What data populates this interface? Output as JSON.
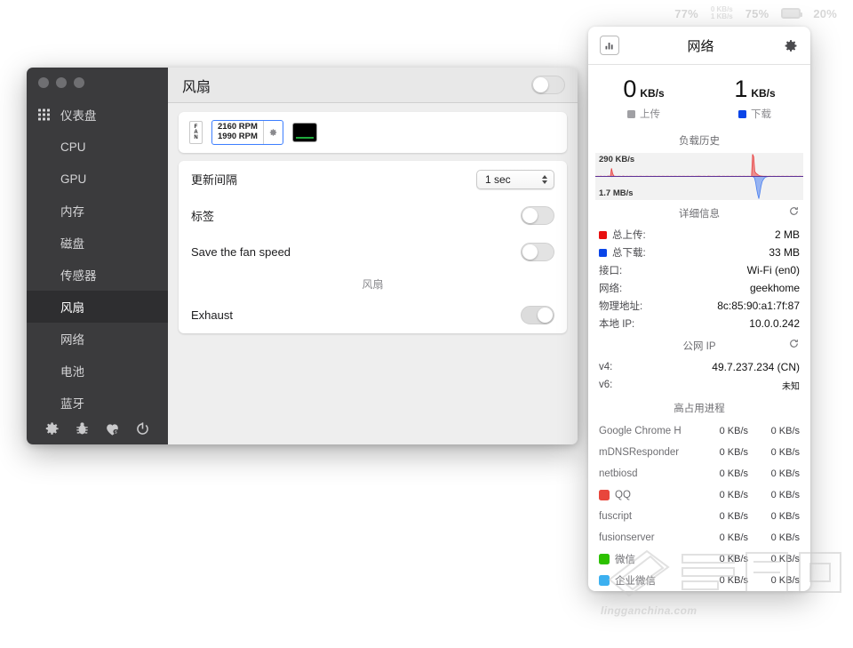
{
  "menubar": {
    "items": [
      {
        "name": "cpu-percent",
        "type": "text",
        "label": "77%"
      },
      {
        "name": "network-speed",
        "type": "stack",
        "top": "0 KB/s",
        "bottom": "1 KB/s"
      },
      {
        "name": "memory-percent",
        "type": "text",
        "label": "75%"
      },
      {
        "name": "battery-icon",
        "type": "battery",
        "label": ""
      },
      {
        "name": "battery-percent",
        "type": "text",
        "label": "20%"
      }
    ]
  },
  "window": {
    "sidebar": {
      "items": [
        {
          "label": "仪表盘",
          "icon": "grid-icon",
          "active": false
        },
        {
          "label": "CPU",
          "icon": "",
          "active": false
        },
        {
          "label": "GPU",
          "icon": "",
          "active": false
        },
        {
          "label": "内存",
          "icon": "",
          "active": false
        },
        {
          "label": "磁盘",
          "icon": "",
          "active": false
        },
        {
          "label": "传感器",
          "icon": "",
          "active": false
        },
        {
          "label": "风扇",
          "icon": "",
          "active": true
        },
        {
          "label": "网络",
          "icon": "",
          "active": false
        },
        {
          "label": "电池",
          "icon": "",
          "active": false
        },
        {
          "label": "蓝牙",
          "icon": "",
          "active": false
        }
      ],
      "tools": [
        "gear-icon",
        "bug-icon",
        "heart-dollar-icon",
        "power-icon"
      ]
    },
    "header": {
      "title": "风扇",
      "toggle_on": false
    },
    "fan_widget": {
      "tag": "FAN",
      "rpm_line1": "2160 RPM",
      "rpm_line2": "1990 RPM",
      "color_swatch": "#000000",
      "accent_bar": "#1faa3c"
    },
    "settings": {
      "update_interval_label": "更新间隔",
      "update_interval_value": "1 sec",
      "label_row": "标签",
      "label_row_on": false,
      "save_fan_speed": "Save the fan speed",
      "save_fan_speed_on": false,
      "section_title": "风扇",
      "exhaust_label": "Exhaust",
      "exhaust_on": true
    }
  },
  "popover": {
    "title": "网络",
    "chart_button": "bar-chart-icon",
    "gear_button": "gear-icon",
    "upload": {
      "value": "0",
      "unit": "KB/s",
      "label": "上传",
      "color": "#a0a0a4"
    },
    "download": {
      "value": "1",
      "unit": "KB/s",
      "label": "下载",
      "color": "#0a45e8"
    },
    "history_title": "负载历史",
    "chart_top_label": "290 KB/s",
    "chart_bottom_label": "1.7 MB/s",
    "details_title": "详细信息",
    "details": [
      {
        "key": "总上传:",
        "value": "2 MB",
        "swatch": "#e81010"
      },
      {
        "key": "总下载:",
        "value": "33 MB",
        "swatch": "#0a45e8"
      },
      {
        "key": "接口:",
        "value": "Wi-Fi (en0)",
        "swatch": ""
      },
      {
        "key": "网络:",
        "value": "geekhome",
        "swatch": ""
      },
      {
        "key": "物理地址:",
        "value": "8c:85:90:a1:7f:87",
        "swatch": ""
      },
      {
        "key": "本地 IP:",
        "value": "10.0.0.242",
        "swatch": ""
      }
    ],
    "public_ip_title": "公网 IP",
    "public_ip": [
      {
        "key": "v4:",
        "value": "49.7.237.234 (CN)",
        "small": false
      },
      {
        "key": "v6:",
        "value": "未知",
        "small": true
      }
    ],
    "processes_title": "高占用进程",
    "processes": [
      {
        "name": "Google Chrome H",
        "up": "0 KB/s",
        "down": "0 KB/s",
        "icon_color": ""
      },
      {
        "name": "mDNSResponder",
        "up": "0 KB/s",
        "down": "0 KB/s",
        "icon_color": ""
      },
      {
        "name": "netbiosd",
        "up": "0 KB/s",
        "down": "0 KB/s",
        "icon_color": ""
      },
      {
        "name": "QQ",
        "up": "0 KB/s",
        "down": "0 KB/s",
        "icon_color": "#e8463c"
      },
      {
        "name": "fuscript",
        "up": "0 KB/s",
        "down": "0 KB/s",
        "icon_color": ""
      },
      {
        "name": "fusionserver",
        "up": "0 KB/s",
        "down": "0 KB/s",
        "icon_color": ""
      },
      {
        "name": "微信",
        "up": "0 KB/s",
        "down": "0 KB/s",
        "icon_color": "#2dc100"
      },
      {
        "name": "企业微信",
        "up": "0 KB/s",
        "down": "0 KB/s",
        "icon_color": "#3cb0f0"
      }
    ]
  },
  "watermark": {
    "text": "lingganchina.com"
  },
  "chart_data": {
    "type": "area",
    "title": "负载历史",
    "orientation": "mirrored",
    "ylabel_top": "290 KB/s",
    "ylabel_bottom": "1.7 MB/s",
    "ylim": [
      -1700,
      290
    ],
    "grid": false,
    "legend_position": "above-chart",
    "series": [
      {
        "name": "上传",
        "color": "#e83a3a",
        "direction": "up",
        "unit": "KB/s",
        "values": [
          3,
          2,
          4,
          3,
          2,
          5,
          3,
          2,
          3,
          4,
          2,
          3,
          6,
          4,
          3,
          95,
          40,
          8,
          4,
          3,
          2,
          3,
          4,
          3,
          2,
          3,
          5,
          3,
          2,
          4,
          3,
          2,
          3,
          4,
          3,
          2,
          3,
          2,
          4,
          3,
          2,
          3,
          4,
          3,
          2,
          3,
          2,
          3,
          4,
          3,
          2,
          3,
          4,
          2,
          3,
          4,
          3,
          2,
          3,
          4,
          3,
          2,
          3,
          4,
          3,
          2,
          3,
          4,
          3,
          2,
          4,
          3,
          2,
          3,
          4,
          3,
          2,
          3,
          4,
          3,
          2,
          3,
          4,
          3,
          2,
          3,
          4,
          3,
          2,
          3,
          4,
          3,
          2,
          3,
          4,
          3,
          5,
          4,
          3,
          2,
          3,
          4,
          3,
          2,
          3,
          5,
          4,
          3,
          2,
          3,
          4,
          3,
          2,
          3,
          4,
          5,
          3,
          2,
          3,
          4,
          3,
          2,
          3,
          4,
          3,
          2,
          3,
          4,
          3,
          2,
          4,
          3,
          2,
          3,
          4,
          3,
          2,
          3,
          4,
          3,
          2,
          3,
          4,
          3,
          2,
          3,
          260,
          230,
          60,
          40,
          30,
          20,
          12,
          8,
          6,
          5,
          4,
          3,
          4,
          3,
          2,
          3,
          4,
          3,
          2,
          3,
          4,
          3,
          2,
          3,
          4,
          3,
          2,
          3,
          4,
          3,
          2,
          3,
          4,
          3,
          2,
          3,
          4,
          3,
          2,
          3,
          4,
          3,
          2,
          3,
          4,
          3,
          2,
          3
        ]
      },
      {
        "name": "下载",
        "color": "#4a7ff0",
        "direction": "down",
        "unit": "KB/s",
        "values": [
          6,
          5,
          7,
          6,
          5,
          8,
          6,
          5,
          6,
          7,
          5,
          6,
          9,
          7,
          6,
          22,
          14,
          8,
          6,
          5,
          4,
          5,
          6,
          5,
          4,
          5,
          8,
          5,
          4,
          6,
          5,
          4,
          5,
          6,
          5,
          4,
          5,
          4,
          6,
          5,
          4,
          5,
          6,
          5,
          4,
          5,
          4,
          5,
          6,
          5,
          4,
          5,
          6,
          4,
          5,
          6,
          5,
          4,
          5,
          6,
          5,
          4,
          5,
          6,
          5,
          4,
          5,
          6,
          5,
          4,
          6,
          5,
          4,
          5,
          6,
          5,
          4,
          5,
          6,
          5,
          4,
          5,
          6,
          5,
          4,
          5,
          6,
          5,
          4,
          5,
          6,
          5,
          4,
          5,
          6,
          5,
          7,
          6,
          5,
          4,
          5,
          6,
          5,
          4,
          5,
          7,
          6,
          5,
          4,
          5,
          6,
          5,
          4,
          5,
          6,
          7,
          5,
          4,
          5,
          6,
          5,
          4,
          5,
          6,
          5,
          4,
          5,
          6,
          5,
          4,
          6,
          5,
          4,
          5,
          6,
          5,
          4,
          5,
          6,
          5,
          4,
          5,
          6,
          5,
          4,
          5,
          40,
          120,
          460,
          980,
          1400,
          1700,
          1250,
          760,
          420,
          260,
          140,
          70,
          40,
          22,
          14,
          9,
          7,
          6,
          5,
          6,
          5,
          4,
          5,
          6,
          5,
          4,
          5,
          6,
          5,
          4,
          5,
          6,
          5,
          4,
          5,
          6,
          5,
          4,
          5,
          6,
          5,
          4,
          5,
          6,
          5,
          4,
          5
        ]
      }
    ]
  }
}
